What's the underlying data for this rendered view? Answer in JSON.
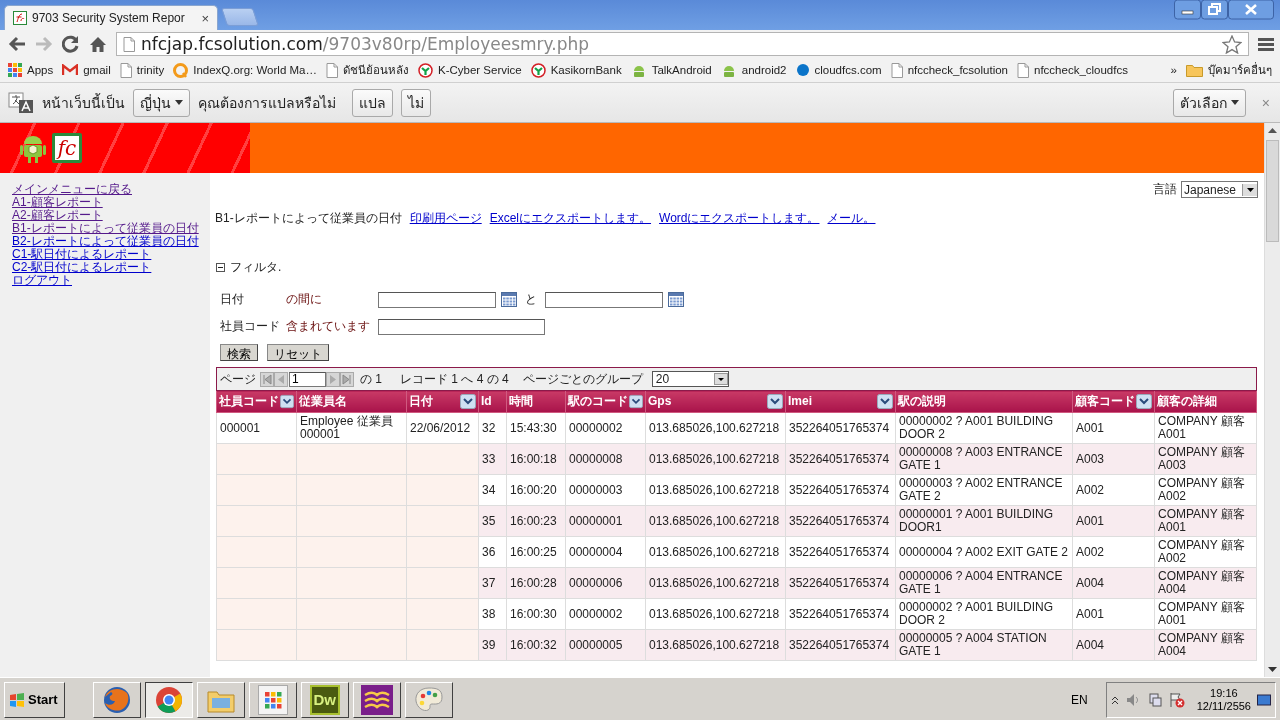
{
  "browser": {
    "tab_title": "9703 Security System Repor",
    "tab_close": "×",
    "url_host": "nfcjap.fcsolution.com",
    "url_path": "/9703v80rp/Employeesmry.php",
    "bookmarks": [
      {
        "label": "Apps",
        "kind": "apps"
      },
      {
        "label": "gmail",
        "kind": "mail"
      },
      {
        "label": "trinity",
        "kind": "page"
      },
      {
        "label": "IndexQ.org: World Ma…",
        "kind": "orange"
      },
      {
        "label": "ดัชนีย้อนหลัง",
        "kind": "page"
      },
      {
        "label": "K-Cyber Service",
        "kind": "bank"
      },
      {
        "label": "KasikornBank",
        "kind": "bank"
      },
      {
        "label": "TalkAndroid",
        "kind": "android"
      },
      {
        "label": "android2",
        "kind": "android"
      },
      {
        "label": "cloudfcs.com",
        "kind": "dot"
      },
      {
        "label": "nfccheck_fcsolution",
        "kind": "page"
      },
      {
        "label": "nfccheck_cloudfcs",
        "kind": "page"
      }
    ],
    "more_bookmarks": "»",
    "other_bookmarks": "บุ๊คมาร์คอื่นๆ"
  },
  "translate_bar": {
    "prefix": "หน้าเว็บนี้เป็น",
    "language": "ญี่ปุ่น",
    "question": "คุณต้องการแปลหรือไม่",
    "buttons": [
      "แปล",
      "ไม่"
    ],
    "options": "ตัวเลือก",
    "close": "×"
  },
  "site": {
    "logo_text": "fc"
  },
  "nav": [
    {
      "label": "メインメニューに戻る",
      "visited": true
    },
    {
      "label": "A1-顧客レポート",
      "visited": true
    },
    {
      "label": "A2-顧客レポート",
      "visited": true
    },
    {
      "label": "B1-レポートによって従業員の日付",
      "visited": true
    },
    {
      "label": "B2-レポートによって従業員の日付",
      "visited": false
    },
    {
      "label": "C1-駅日付によるレポート",
      "visited": false
    },
    {
      "label": "C2-駅日付によるレポート",
      "visited": false
    },
    {
      "label": "ログアウト",
      "visited": false
    }
  ],
  "language": {
    "label": "言語",
    "value": "Japanese"
  },
  "report": {
    "title": "B1-レポートによって従業員の日付",
    "links": [
      "印刷用ページ",
      "Excelにエクスポートします。",
      "Wordにエクスポートします。",
      "メール。"
    ]
  },
  "filter": {
    "label": "フィルタ.",
    "expanded": true,
    "fields": [
      {
        "label": "日付",
        "operator": "の間に",
        "kind": "range",
        "joiner": "と"
      },
      {
        "label": "社員コード",
        "operator": "含まれています",
        "kind": "text"
      }
    ],
    "buttons": [
      "検索",
      "リセット"
    ]
  },
  "pager": {
    "page_label": "ページ",
    "page": "1",
    "of": "の 1",
    "records": "レコード 1 へ 4 の 4",
    "group_label": "ページごとのグループ",
    "group_size": "20"
  },
  "table": {
    "columns": [
      {
        "label": "社員コード",
        "filter": true
      },
      {
        "label": "従業員名",
        "filter": false
      },
      {
        "label": "日付",
        "filter": true
      },
      {
        "label": "Id",
        "filter": false
      },
      {
        "label": "時間",
        "filter": false
      },
      {
        "label": "駅のコード",
        "filter": true
      },
      {
        "label": "Gps",
        "filter": true
      },
      {
        "label": "Imei",
        "filter": true
      },
      {
        "label": "駅の説明",
        "filter": false
      },
      {
        "label": "顧客コード",
        "filter": true
      },
      {
        "label": "顧客の詳細",
        "filter": false
      }
    ],
    "rows": [
      {
        "cells": [
          "000001",
          "Employee 従業員 000001",
          "22/06/2012",
          "32",
          "15:43:30",
          "00000002",
          "013.685026,100.627218",
          "352264051765374",
          "00000002 ? A001 BUILDING DOOR 2",
          "A001",
          "COMPANY 顧客 A001"
        ]
      },
      {
        "cells": [
          "",
          "",
          "",
          "33",
          "16:00:18",
          "00000008",
          "013.685026,100.627218",
          "352264051765374",
          "00000008 ? A003 ENTRANCE GATE 1",
          "A003",
          "COMPANY 顧客 A003"
        ]
      },
      {
        "cells": [
          "",
          "",
          "",
          "34",
          "16:00:20",
          "00000003",
          "013.685026,100.627218",
          "352264051765374",
          "00000003 ? A002 ENTRANCE GATE 2",
          "A002",
          "COMPANY 顧客 A002"
        ]
      },
      {
        "cells": [
          "",
          "",
          "",
          "35",
          "16:00:23",
          "00000001",
          "013.685026,100.627218",
          "352264051765374",
          "00000001 ? A001 BUILDING DOOR1",
          "A001",
          "COMPANY 顧客 A001"
        ]
      },
      {
        "cells": [
          "",
          "",
          "",
          "36",
          "16:00:25",
          "00000004",
          "013.685026,100.627218",
          "352264051765374",
          "00000004 ? A002 EXIT GATE 2",
          "A002",
          "COMPANY 顧客 A002"
        ]
      },
      {
        "cells": [
          "",
          "",
          "",
          "37",
          "16:00:28",
          "00000006",
          "013.685026,100.627218",
          "352264051765374",
          "00000006 ? A004 ENTRANCE GATE 1",
          "A004",
          "COMPANY 顧客 A004"
        ]
      },
      {
        "cells": [
          "",
          "",
          "",
          "38",
          "16:00:30",
          "00000002",
          "013.685026,100.627218",
          "352264051765374",
          "00000002 ? A001 BUILDING DOOR 2",
          "A001",
          "COMPANY 顧客 A001"
        ]
      },
      {
        "cells": [
          "",
          "",
          "",
          "39",
          "16:00:32",
          "00000005",
          "013.685026,100.627218",
          "352264051765374",
          "00000005 ? A004 STATION GATE 1",
          "A004",
          "COMPANY 顧客 A004"
        ]
      }
    ]
  },
  "taskbar": {
    "start": "Start",
    "apps": [
      {
        "kind": "firefox",
        "active": false
      },
      {
        "kind": "chrome",
        "active": true
      },
      {
        "kind": "explorer",
        "active": false
      },
      {
        "kind": "grid",
        "active": false
      },
      {
        "kind": "dreamweaver",
        "label": "Dw",
        "active": false
      },
      {
        "kind": "book",
        "active": false
      },
      {
        "kind": "paint",
        "active": false
      }
    ],
    "language": "EN",
    "time": "19:16",
    "date": "12/11/2556"
  }
}
